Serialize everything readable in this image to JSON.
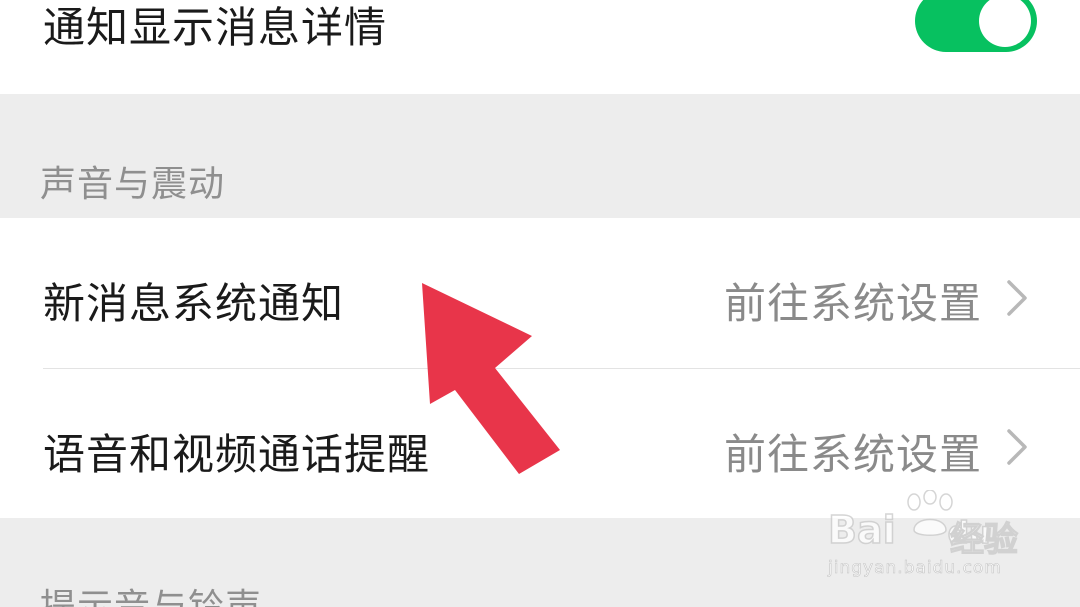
{
  "top_row": {
    "label": "通知显示消息详情",
    "toggle_on": true
  },
  "sections": [
    {
      "header": "声音与震动",
      "items": [
        {
          "label": "新消息系统通知",
          "value": "前往系统设置"
        },
        {
          "label": "语音和视频通话提醒",
          "value": "前往系统设置"
        }
      ]
    },
    {
      "header": "提示音与铃声"
    }
  ],
  "watermark": {
    "brand": "Bai",
    "brand_suffix": "du",
    "sub": "经验",
    "url": "jingyan.baidu.com"
  },
  "colors": {
    "toggle_on": "#07c160",
    "arrow": "#e8354a",
    "background": "#ededed"
  }
}
